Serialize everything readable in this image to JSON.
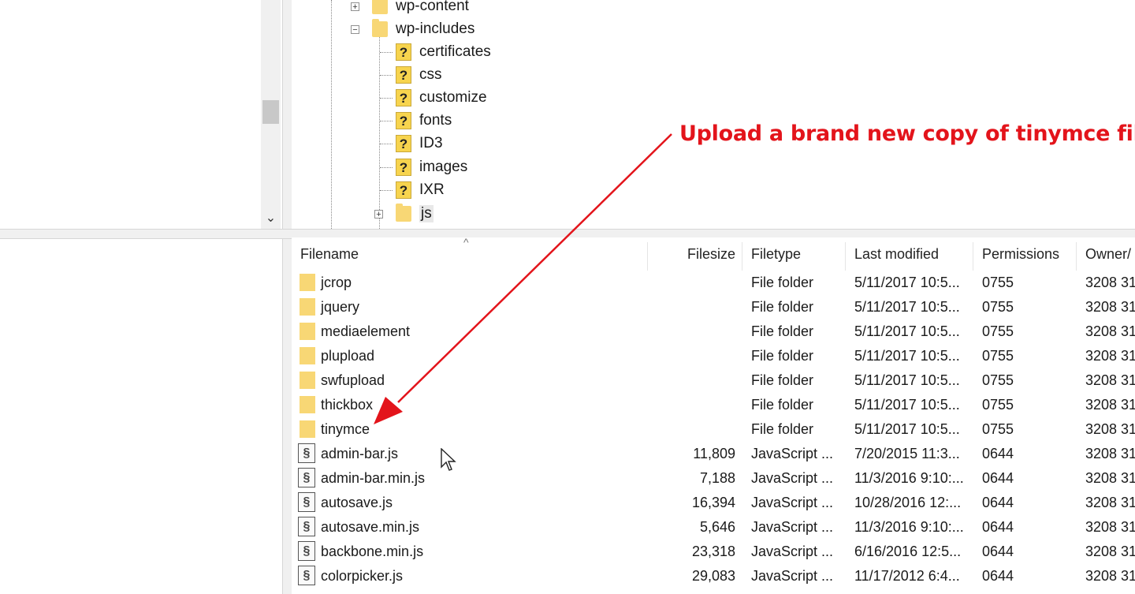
{
  "tree": {
    "nodes": [
      {
        "label": "wp-content",
        "type": "folder",
        "expander": "+"
      },
      {
        "label": "wp-includes",
        "type": "folder",
        "expander": "−"
      },
      {
        "label": "certificates",
        "type": "unknown"
      },
      {
        "label": "css",
        "type": "unknown"
      },
      {
        "label": "customize",
        "type": "unknown"
      },
      {
        "label": "fonts",
        "type": "unknown"
      },
      {
        "label": "ID3",
        "type": "unknown"
      },
      {
        "label": "images",
        "type": "unknown"
      },
      {
        "label": "IXR",
        "type": "unknown"
      },
      {
        "label": "js",
        "type": "folder",
        "expander": "+",
        "selected": true
      }
    ]
  },
  "list": {
    "columns": {
      "filename": "Filename",
      "filesize": "Filesize",
      "filetype": "Filetype",
      "modified": "Last modified",
      "permissions": "Permissions",
      "owner": "Owner/"
    },
    "rows": [
      {
        "name": "jcrop",
        "size": "",
        "type": "File folder",
        "modified": "5/11/2017 10:5...",
        "perm": "0755",
        "owner": "3208 31",
        "icon": "folder"
      },
      {
        "name": "jquery",
        "size": "",
        "type": "File folder",
        "modified": "5/11/2017 10:5...",
        "perm": "0755",
        "owner": "3208 31",
        "icon": "folder"
      },
      {
        "name": "mediaelement",
        "size": "",
        "type": "File folder",
        "modified": "5/11/2017 10:5...",
        "perm": "0755",
        "owner": "3208 31",
        "icon": "folder"
      },
      {
        "name": "plupload",
        "size": "",
        "type": "File folder",
        "modified": "5/11/2017 10:5...",
        "perm": "0755",
        "owner": "3208 31",
        "icon": "folder"
      },
      {
        "name": "swfupload",
        "size": "",
        "type": "File folder",
        "modified": "5/11/2017 10:5...",
        "perm": "0755",
        "owner": "3208 31",
        "icon": "folder"
      },
      {
        "name": "thickbox",
        "size": "",
        "type": "File folder",
        "modified": "5/11/2017 10:5...",
        "perm": "0755",
        "owner": "3208 31",
        "icon": "folder"
      },
      {
        "name": "tinymce",
        "size": "",
        "type": "File folder",
        "modified": "5/11/2017 10:5...",
        "perm": "0755",
        "owner": "3208 31",
        "icon": "folder"
      },
      {
        "name": "admin-bar.js",
        "size": "11,809",
        "type": "JavaScript ...",
        "modified": "7/20/2015 11:3...",
        "perm": "0644",
        "owner": "3208 31",
        "icon": "js"
      },
      {
        "name": "admin-bar.min.js",
        "size": "7,188",
        "type": "JavaScript ...",
        "modified": "11/3/2016 9:10:...",
        "perm": "0644",
        "owner": "3208 31",
        "icon": "js"
      },
      {
        "name": "autosave.js",
        "size": "16,394",
        "type": "JavaScript ...",
        "modified": "10/28/2016 12:...",
        "perm": "0644",
        "owner": "3208 31",
        "icon": "js"
      },
      {
        "name": "autosave.min.js",
        "size": "5,646",
        "type": "JavaScript ...",
        "modified": "11/3/2016 9:10:...",
        "perm": "0644",
        "owner": "3208 31",
        "icon": "js"
      },
      {
        "name": "backbone.min.js",
        "size": "23,318",
        "type": "JavaScript ...",
        "modified": "6/16/2016 12:5...",
        "perm": "0644",
        "owner": "3208 31",
        "icon": "js"
      },
      {
        "name": "colorpicker.js",
        "size": "29,083",
        "type": "JavaScript ...",
        "modified": "11/17/2012 6:4...",
        "perm": "0644",
        "owner": "3208 31",
        "icon": "js"
      }
    ]
  },
  "annotation": {
    "text": "Upload a brand new copy of tinymce file",
    "color": "#e3141b"
  },
  "icons": {
    "folder": "folder-icon",
    "unknown": "question-folder-icon",
    "js": "javascript-file-icon",
    "scroll_down": "chevron-down-icon"
  }
}
